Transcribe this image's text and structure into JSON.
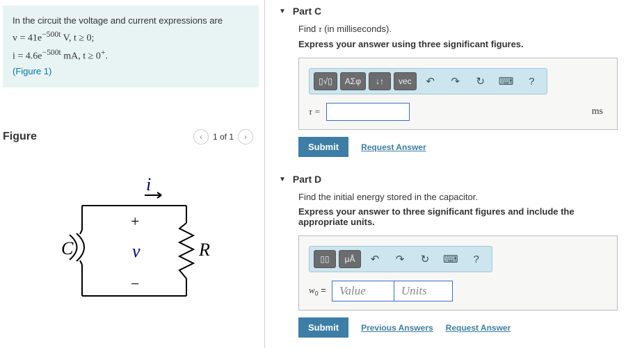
{
  "problem": {
    "intro": "In the circuit the voltage and current expressions are",
    "eq1_html": "v = 41e<sup>−500t</sup> V,  t ≥ 0;",
    "eq2_html": "i = 4.6e<sup>−500t</sup> mA,  t ≥ 0<sup>+</sup>.",
    "figure_link": "(Figure 1)"
  },
  "figure": {
    "title": "Figure",
    "page_label": "1 of 1",
    "labels": {
      "i": "i",
      "v": "v",
      "C": "C",
      "R": "R",
      "plus": "+",
      "minus": "−"
    }
  },
  "parts": [
    {
      "id": "partC",
      "title": "Part C",
      "prompt_html": "Find <span class='var'>τ</span> (in milliseconds).",
      "instruct": "Express your answer using three significant figures.",
      "toolbar": {
        "templates": "▯√▯",
        "greek": "ΑΣφ",
        "updown": "↓↑",
        "vec": "vec",
        "undo": "↶",
        "redo": "↷",
        "reset": "↻",
        "keyboard": "⌨",
        "help": "?"
      },
      "var_label": "τ =",
      "unit_tail": "ms",
      "submit": "Submit",
      "links": [
        "Request Answer"
      ]
    },
    {
      "id": "partD",
      "title": "Part D",
      "prompt": "Find the initial energy stored in the capacitor.",
      "instruct": "Express your answer to three significant figures and include the appropriate units.",
      "toolbar": {
        "templates": "▯▯",
        "units": "μÅ",
        "undo": "↶",
        "redo": "↷",
        "reset": "↻",
        "keyboard": "⌨",
        "help": "?"
      },
      "var_label_html": "<span class='var'>w</span><span class='sub'>0</span> =",
      "value_placeholder": "Value",
      "units_placeholder": "Units",
      "submit": "Submit",
      "links": [
        "Previous Answers",
        "Request Answer"
      ]
    }
  ]
}
